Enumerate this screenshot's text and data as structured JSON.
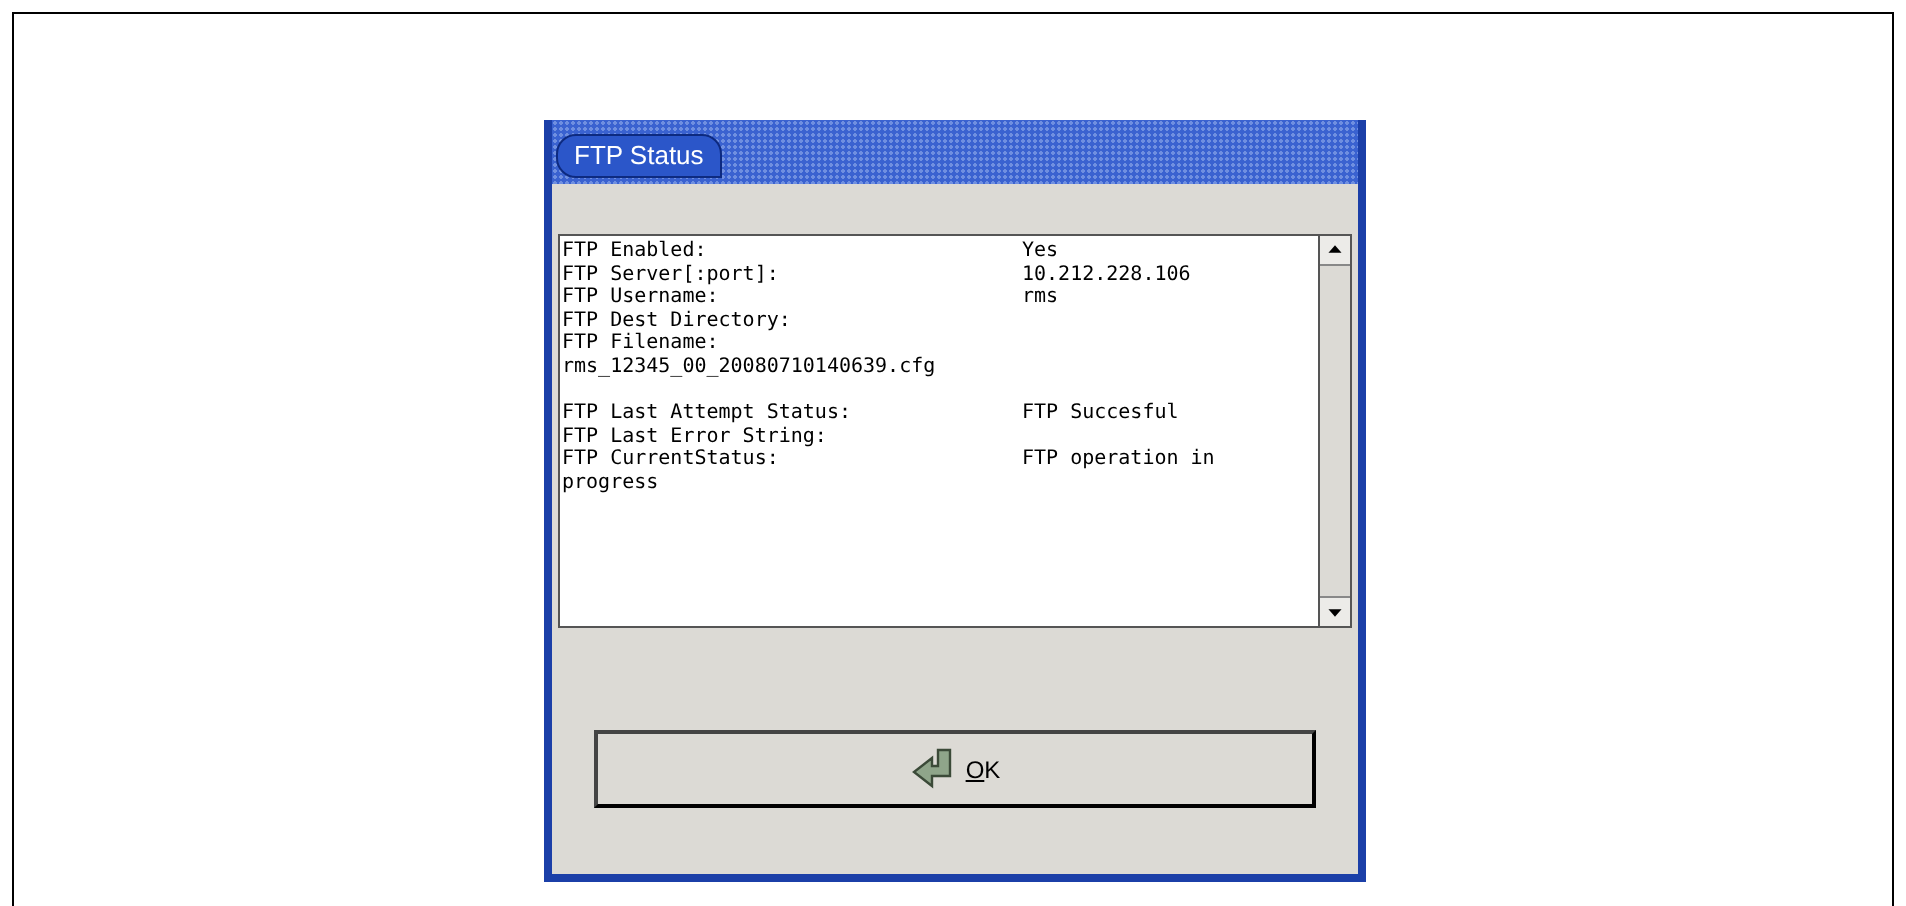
{
  "window": {
    "title": "FTP Status"
  },
  "status_lines": [
    {
      "label": "FTP Enabled:",
      "value": "Yes"
    },
    {
      "label": "FTP Server[:port]:",
      "value": "10.212.228.106"
    },
    {
      "label": "FTP Username:",
      "value": "rms"
    },
    {
      "label": "FTP Dest Directory:"
    },
    {
      "label": "FTP Filename:"
    },
    {
      "label": "rms_12345_00_20080710140639.cfg"
    },
    {
      "label": "FTP Last Attempt Status:",
      "value": "FTP Succesful",
      "gap_before": true
    },
    {
      "label": "FTP Last Error String:"
    },
    {
      "label": "FTP CurrentStatus:",
      "value": "FTP operation in"
    },
    {
      "label": "progress"
    }
  ],
  "buttons": [
    {
      "label_parts": [
        {
          "text": "O",
          "underlined": true
        },
        {
          "text": "K",
          "underlined": false
        }
      ]
    }
  ]
}
